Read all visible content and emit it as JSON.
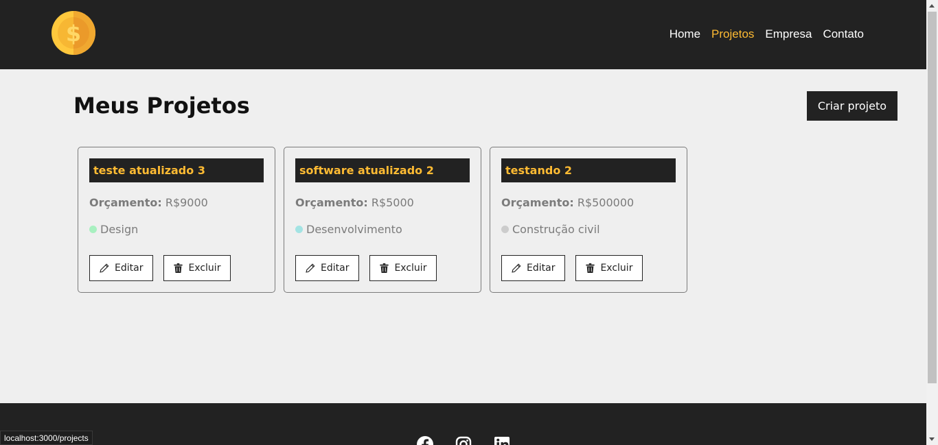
{
  "nav": {
    "links": [
      {
        "label": "Home"
      },
      {
        "label": "Projetos"
      },
      {
        "label": "Empresa"
      },
      {
        "label": "Contato"
      }
    ]
  },
  "page": {
    "title": "Meus Projetos",
    "create_label": "Criar projeto"
  },
  "projects": [
    {
      "name": "teste atualizado 3",
      "budget_label": "Orçamento:",
      "budget": "R$9000",
      "category": "Design",
      "category_color": "#a8f0c0",
      "edit": "Editar",
      "delete": "Excluir"
    },
    {
      "name": "software atualizado 2",
      "budget_label": "Orçamento:",
      "budget": "R$5000",
      "category": "Desenvolvimento",
      "category_color": "#a3e3e3",
      "edit": "Editar",
      "delete": "Excluir"
    },
    {
      "name": "testando 2",
      "budget_label": "Orçamento:",
      "budget": "R$500000",
      "category": "Construção civil",
      "category_color": "#cccccc",
      "edit": "Editar",
      "delete": "Excluir"
    }
  ],
  "footer": {
    "social": [
      "facebook-icon",
      "instagram-icon",
      "linkedin-icon"
    ]
  },
  "status": {
    "url": "localhost:3000/projects"
  },
  "colors": {
    "accent": "#ffbb33",
    "dark": "#222222",
    "background": "#efefef"
  }
}
